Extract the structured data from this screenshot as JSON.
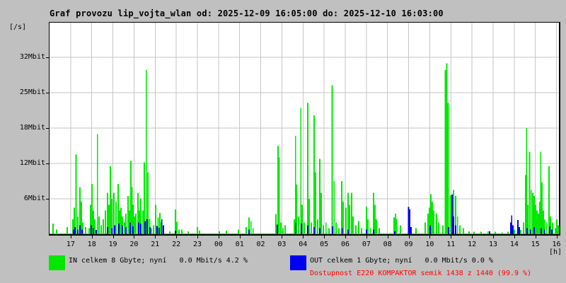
{
  "title": "Graf provozu lip_vojta_wlan od: 2025-12-09 16:05:00 do: 2025-12-10 16:03:00",
  "y_axis": {
    "unit_label": "[/s]",
    "ticks": [
      {
        "label": "32Mbit",
        "value": 32
      },
      {
        "label": "25Mbit",
        "value": 25
      },
      {
        "label": "18Mbit",
        "value": 18
      },
      {
        "label": "12Mbit",
        "value": 12
      },
      {
        "label": "6Mbit",
        "value": 6
      }
    ]
  },
  "x_axis": {
    "unit_label": "[h]",
    "ticks": [
      {
        "label": "17",
        "hour": 1
      },
      {
        "label": "18",
        "hour": 2
      },
      {
        "label": "19",
        "hour": 3
      },
      {
        "label": "20",
        "hour": 4
      },
      {
        "label": "21",
        "hour": 5
      },
      {
        "label": "22",
        "hour": 6
      },
      {
        "label": "23",
        "hour": 7
      },
      {
        "label": "00",
        "hour": 8
      },
      {
        "label": "01",
        "hour": 9
      },
      {
        "label": "02",
        "hour": 10
      },
      {
        "label": "03",
        "hour": 11
      },
      {
        "label": "04",
        "hour": 12
      },
      {
        "label": "05",
        "hour": 13
      },
      {
        "label": "06",
        "hour": 14
      },
      {
        "label": "07",
        "hour": 15
      },
      {
        "label": "08",
        "hour": 16
      },
      {
        "label": "09",
        "hour": 17
      },
      {
        "label": "10",
        "hour": 18
      },
      {
        "label": "11",
        "hour": 19
      },
      {
        "label": "12",
        "hour": 20
      },
      {
        "label": "13",
        "hour": 21
      },
      {
        "label": "14",
        "hour": 22
      },
      {
        "label": "15",
        "hour": 23
      },
      {
        "label": "16",
        "hour": 24
      }
    ]
  },
  "legend": {
    "in": {
      "label": "IN celkem 8 Gbyte; nyní   0.0 Mbit/s 4.2 %",
      "color": "#00e800"
    },
    "out": {
      "label": "OUT celkem 1 Gbyte; nyní   0.0 Mbit/s 0.0 %",
      "color": "#0000f0"
    },
    "availability": {
      "label": "Dostupnost E220 KOMPAKTOR semik 1438 z 1440 (99.9 %)",
      "color": "#ff0000"
    }
  },
  "colors": {
    "background": "#c0c0c0",
    "plot_background": "#ffffff",
    "grid": "#c6c6c6",
    "axis": "#000000",
    "in": "#00e800",
    "out": "#0000f0",
    "availability_text": "#ff0000"
  },
  "chart_data": {
    "type": "line",
    "title": "Graf provozu lip_vojta_wlan od: 2025-12-09 16:05:00 do: 2025-12-10 16:03:00",
    "xlabel": "[h]",
    "ylabel": "[/s]",
    "x_unit": "hours after 16:00 (2025-12-09 16:05 to 2025-12-10 16:03)",
    "y_unit": "Mbit/s",
    "x_range": [
      0,
      24.05
    ],
    "y_tick_values": [
      6,
      12,
      18,
      25,
      32
    ],
    "grid": true,
    "legend_position": "bottom",
    "style": "vertical spike lines from zero baseline (MRTG)",
    "series": [
      {
        "name": "IN",
        "color": "#00e800",
        "points": [
          [
            0.17,
            1.8
          ],
          [
            0.33,
            0.8
          ],
          [
            0.84,
            1.2
          ],
          [
            1.11,
            2.5
          ],
          [
            1.17,
            4.5
          ],
          [
            1.26,
            13.5
          ],
          [
            1.34,
            3
          ],
          [
            1.44,
            8
          ],
          [
            1.51,
            5.5
          ],
          [
            1.57,
            2
          ],
          [
            1.71,
            1.2
          ],
          [
            1.88,
            1
          ],
          [
            1.94,
            5
          ],
          [
            2.01,
            8.5
          ],
          [
            2.08,
            4
          ],
          [
            2.14,
            2.5
          ],
          [
            2.27,
            17
          ],
          [
            2.34,
            3
          ],
          [
            2.44,
            1.5
          ],
          [
            2.55,
            2.5
          ],
          [
            2.65,
            4
          ],
          [
            2.75,
            7
          ],
          [
            2.81,
            5
          ],
          [
            2.88,
            11.5
          ],
          [
            2.95,
            6
          ],
          [
            3.05,
            7
          ],
          [
            3.15,
            5.5
          ],
          [
            3.25,
            8.5
          ],
          [
            3.32,
            4
          ],
          [
            3.38,
            4.5
          ],
          [
            3.45,
            3
          ],
          [
            3.55,
            2
          ],
          [
            3.62,
            3.5
          ],
          [
            3.72,
            6.5
          ],
          [
            3.78,
            4
          ],
          [
            3.85,
            12.4
          ],
          [
            3.9,
            8
          ],
          [
            3.96,
            5
          ],
          [
            4.02,
            3
          ],
          [
            4.09,
            3.5
          ],
          [
            4.19,
            7
          ],
          [
            4.25,
            4
          ],
          [
            4.32,
            6
          ],
          [
            4.42,
            4
          ],
          [
            4.49,
            12.2
          ],
          [
            4.58,
            29.5
          ],
          [
            4.66,
            10.5
          ],
          [
            4.74,
            2.6
          ],
          [
            4.82,
            1
          ],
          [
            4.92,
            1.5
          ],
          [
            5.02,
            5
          ],
          [
            5.14,
            2.8
          ],
          [
            5.22,
            3.6
          ],
          [
            5.29,
            2
          ],
          [
            5.39,
            1.5
          ],
          [
            5.69,
            0.5
          ],
          [
            5.96,
            4.2
          ],
          [
            6.03,
            2.1
          ],
          [
            6.13,
            0.8
          ],
          [
            6.26,
            0.8
          ],
          [
            6.56,
            0.5
          ],
          [
            7.0,
            1.2
          ],
          [
            7.1,
            0.6
          ],
          [
            8.04,
            0.5
          ],
          [
            8.37,
            0.6
          ],
          [
            8.94,
            0.8
          ],
          [
            9.31,
            1.2
          ],
          [
            9.44,
            2.8
          ],
          [
            9.54,
            2.2
          ],
          [
            9.64,
            1
          ],
          [
            10.72,
            3.4
          ],
          [
            10.82,
            15
          ],
          [
            10.87,
            13
          ],
          [
            10.95,
            2
          ],
          [
            11.05,
            1
          ],
          [
            11.15,
            1.5
          ],
          [
            11.59,
            2.5
          ],
          [
            11.65,
            16.7
          ],
          [
            11.7,
            8.4
          ],
          [
            11.79,
            3
          ],
          [
            11.9,
            22
          ],
          [
            11.96,
            5
          ],
          [
            12.06,
            2
          ],
          [
            12.22,
            23
          ],
          [
            12.29,
            6
          ],
          [
            12.39,
            2
          ],
          [
            12.53,
            20.5
          ],
          [
            12.59,
            10.5
          ],
          [
            12.69,
            2.5
          ],
          [
            12.79,
            12.8
          ],
          [
            12.86,
            7
          ],
          [
            12.96,
            1.5
          ],
          [
            13.09,
            2
          ],
          [
            13.23,
            1
          ],
          [
            13.38,
            26.5
          ],
          [
            13.47,
            9
          ],
          [
            13.56,
            2
          ],
          [
            13.7,
            1
          ],
          [
            13.83,
            9
          ],
          [
            13.9,
            5.5
          ],
          [
            14.03,
            4.5
          ],
          [
            14.13,
            7
          ],
          [
            14.2,
            5
          ],
          [
            14.3,
            7
          ],
          [
            14.37,
            3
          ],
          [
            14.5,
            1.5
          ],
          [
            14.64,
            2.2
          ],
          [
            14.77,
            1
          ],
          [
            15.0,
            4.7
          ],
          [
            15.07,
            2.5
          ],
          [
            15.2,
            1
          ],
          [
            15.34,
            7
          ],
          [
            15.41,
            5
          ],
          [
            15.47,
            2.5
          ],
          [
            15.61,
            1
          ],
          [
            16.31,
            2.8
          ],
          [
            16.38,
            3.5
          ],
          [
            16.44,
            2.5
          ],
          [
            16.61,
            1.5
          ],
          [
            17.01,
            1
          ],
          [
            17.35,
            1
          ],
          [
            17.78,
            2
          ],
          [
            17.92,
            3.5
          ],
          [
            17.99,
            4.5
          ],
          [
            18.05,
            6.8
          ],
          [
            18.12,
            5.5
          ],
          [
            18.19,
            4
          ],
          [
            18.32,
            3.5
          ],
          [
            18.42,
            2
          ],
          [
            18.62,
            1.5
          ],
          [
            18.74,
            29.5
          ],
          [
            18.81,
            30.8
          ],
          [
            18.87,
            23
          ],
          [
            18.97,
            6.6
          ],
          [
            19.06,
            2
          ],
          [
            19.12,
            7.5
          ],
          [
            19.22,
            6.5
          ],
          [
            19.32,
            3
          ],
          [
            19.43,
            1.5
          ],
          [
            19.59,
            1
          ],
          [
            19.86,
            0.5
          ],
          [
            20.1,
            0.4
          ],
          [
            20.43,
            0.4
          ],
          [
            20.76,
            0.5
          ],
          [
            21.1,
            0.4
          ],
          [
            21.43,
            0.3
          ],
          [
            21.7,
            0.4
          ],
          [
            21.84,
            1
          ],
          [
            22.0,
            0.8
          ],
          [
            22.17,
            1.5
          ],
          [
            22.31,
            0.7
          ],
          [
            22.44,
            2
          ],
          [
            22.53,
            10
          ],
          [
            22.58,
            18
          ],
          [
            22.64,
            5
          ],
          [
            22.72,
            14
          ],
          [
            22.8,
            7.5
          ],
          [
            22.88,
            7
          ],
          [
            22.94,
            6.5
          ],
          [
            23.01,
            5
          ],
          [
            23.08,
            4
          ],
          [
            23.14,
            3.5
          ],
          [
            23.21,
            5.5
          ],
          [
            23.25,
            14
          ],
          [
            23.31,
            8.8
          ],
          [
            23.38,
            4
          ],
          [
            23.44,
            2.5
          ],
          [
            23.54,
            2
          ],
          [
            23.65,
            11.5
          ],
          [
            23.71,
            3
          ],
          [
            23.81,
            2
          ],
          [
            23.95,
            1
          ],
          [
            24.01,
            2.5
          ],
          [
            24.08,
            1.5
          ]
        ]
      },
      {
        "name": "OUT",
        "color": "#0000f0",
        "points": [
          [
            1.14,
            0.8
          ],
          [
            1.21,
            1.2
          ],
          [
            1.34,
            0.8
          ],
          [
            1.44,
            1.5
          ],
          [
            1.54,
            0.8
          ],
          [
            1.98,
            1.5
          ],
          [
            2.08,
            1
          ],
          [
            2.21,
            0.7
          ],
          [
            2.75,
            1.2
          ],
          [
            2.95,
            1
          ],
          [
            3.08,
            1.5
          ],
          [
            3.28,
            1.8
          ],
          [
            3.45,
            1.5
          ],
          [
            3.62,
            1.2
          ],
          [
            3.82,
            2
          ],
          [
            3.95,
            1.3
          ],
          [
            4.22,
            2
          ],
          [
            4.32,
            1.8
          ],
          [
            4.52,
            2.2
          ],
          [
            4.62,
            2.5
          ],
          [
            4.76,
            1.2
          ],
          [
            5.09,
            1.4
          ],
          [
            5.19,
            1.1
          ],
          [
            5.32,
            2.5
          ],
          [
            5.39,
            1.5
          ],
          [
            5.96,
            0.6
          ],
          [
            9.44,
            0.8
          ],
          [
            10.78,
            1.6
          ],
          [
            11.65,
            2
          ],
          [
            11.92,
            1.8
          ],
          [
            12.22,
            1.5
          ],
          [
            12.53,
            1.2
          ],
          [
            12.79,
            1
          ],
          [
            13.4,
            1.3
          ],
          [
            13.86,
            1
          ],
          [
            14.13,
            0.8
          ],
          [
            15.0,
            0.8
          ],
          [
            15.34,
            0.8
          ],
          [
            16.34,
            0.5
          ],
          [
            17.0,
            4.6
          ],
          [
            17.05,
            4.2
          ],
          [
            17.11,
            1.2
          ],
          [
            18.02,
            1.5
          ],
          [
            18.89,
            1.2
          ],
          [
            19.06,
            6.7
          ],
          [
            19.12,
            3
          ],
          [
            19.22,
            1.5
          ],
          [
            20.83,
            0.5
          ],
          [
            21.84,
            2
          ],
          [
            21.88,
            3.2
          ],
          [
            21.94,
            1.5
          ],
          [
            22.17,
            2.4
          ],
          [
            22.24,
            1.2
          ],
          [
            22.61,
            1
          ],
          [
            22.77,
            0.8
          ],
          [
            22.94,
            1.2
          ],
          [
            23.28,
            1
          ],
          [
            23.44,
            0.8
          ],
          [
            23.68,
            1.3
          ],
          [
            23.78,
            0.8
          ]
        ]
      }
    ]
  }
}
